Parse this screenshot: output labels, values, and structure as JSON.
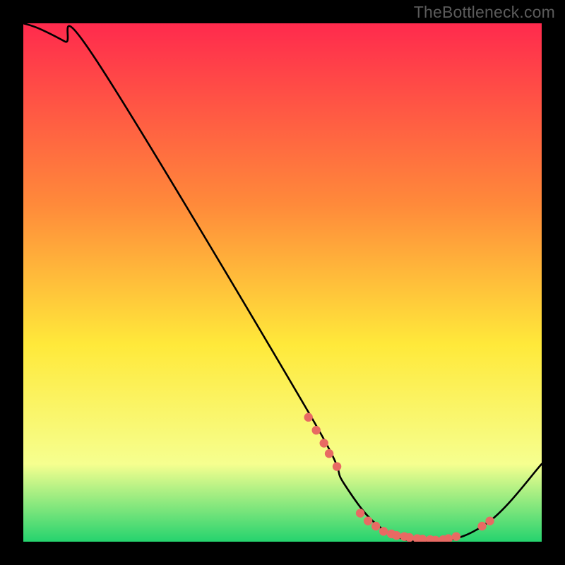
{
  "watermark": "TheBottleneck.com",
  "colors": {
    "gradient_top": "#ff2a4d",
    "gradient_mid_upper": "#ff8a3a",
    "gradient_mid": "#ffe93a",
    "gradient_mid_lower": "#f6ff8f",
    "gradient_bottom": "#25d36e",
    "curve": "#000000",
    "dot_fill": "#e86a63",
    "dot_stroke": "#c84a44",
    "background": "#000000"
  },
  "chart_data": {
    "type": "line",
    "title": "",
    "xlabel": "",
    "ylabel": "",
    "xlim": [
      0,
      100
    ],
    "ylim": [
      0,
      100
    ],
    "curve": {
      "name": "bottleneck-curve",
      "x": [
        0,
        3,
        8,
        14,
        55,
        62,
        70,
        80,
        90,
        100
      ],
      "y": [
        100,
        99,
        96.5,
        93,
        25,
        11,
        2,
        0,
        4,
        15
      ]
    },
    "series": [
      {
        "name": "red-dots",
        "x": [
          55.0,
          56.5,
          58.0,
          59.0,
          60.5,
          65.0,
          66.5,
          68.0,
          69.5,
          71.0,
          72.0,
          73.5,
          74.5,
          76.0,
          77.0,
          78.5,
          79.5,
          81.0,
          82.0,
          83.5,
          88.5,
          90.0
        ],
        "y": [
          24.0,
          21.5,
          19.0,
          17.0,
          14.5,
          5.5,
          4.0,
          3.0,
          2.0,
          1.5,
          1.2,
          1.0,
          0.8,
          0.6,
          0.5,
          0.4,
          0.3,
          0.4,
          0.6,
          1.0,
          3.0,
          4.0
        ]
      }
    ]
  }
}
